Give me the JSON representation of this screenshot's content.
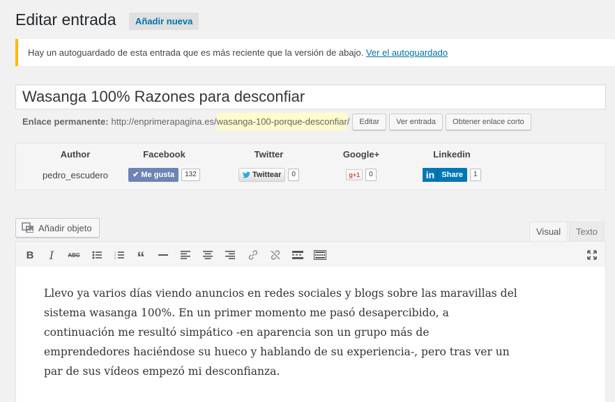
{
  "header": {
    "title": "Editar entrada",
    "add_new": "Añadir nueva"
  },
  "notice": {
    "text": "Hay un autoguardado de esta entrada que es más reciente que la versión de abajo.",
    "link": "Ver el autoguardado"
  },
  "post": {
    "title": "Wasanga 100% Razones para desconfiar"
  },
  "permalink": {
    "label": "Enlace permanente:",
    "base": "http://enprimerapagina.es/",
    "slug": "wasanga-100-porque-desconfiar",
    "trail": "/",
    "edit": "Editar",
    "view": "Ver entrada",
    "shortlink": "Obtener enlace corto"
  },
  "social": {
    "author_head": "Author",
    "author": "pedro_escudero",
    "facebook_head": "Facebook",
    "facebook_btn": "Me gusta",
    "facebook_count": "132",
    "twitter_head": "Twitter",
    "twitter_btn": "Twittear",
    "twitter_count": "0",
    "google_head": "Google+",
    "google_btn": "g+1",
    "google_count": "0",
    "linkedin_head": "Linkedin",
    "linkedin_btn": "Share",
    "linkedin_count": "1"
  },
  "editor": {
    "add_media": "Añadir objeto",
    "tab_visual": "Visual",
    "tab_text": "Texto",
    "content": "Llevo ya varios días viendo anuncios en redes sociales y blogs sobre las maravillas del sistema wasanga 100%. En un primer momento me pasó desapercibido, a continuación me resultó simpático -en aparencia son un grupo más de emprendedores haciéndose su hueco y hablando de su experiencia-, pero tras ver un par de sus vídeos  empezó mi desconfianza."
  },
  "colors": {
    "link": "#0073aa",
    "notice_border": "#ffb900",
    "facebook": "#6d84b4",
    "linkedin": "#0077b5"
  }
}
